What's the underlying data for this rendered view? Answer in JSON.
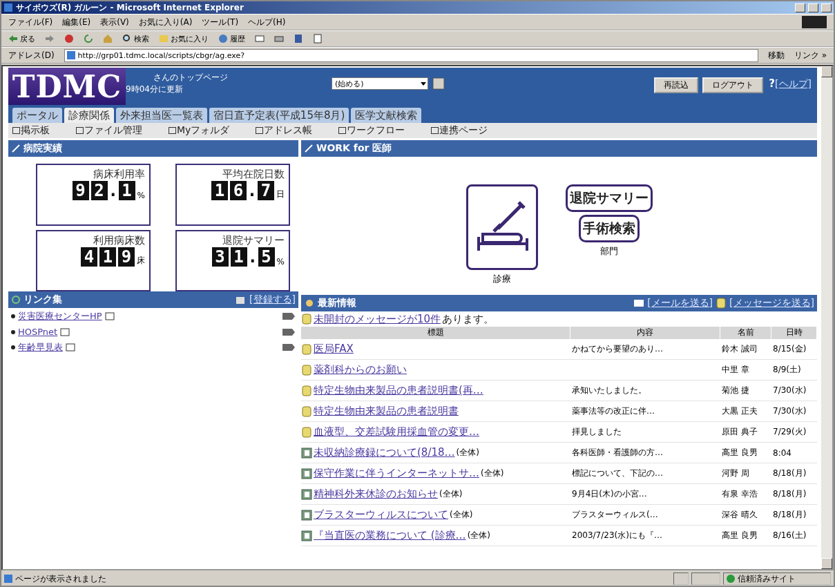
{
  "window": {
    "title": "サイボウズ(R) ガルーン - Microsoft Internet Explorer"
  },
  "menu": [
    "ファイル(F)",
    "編集(E)",
    "表示(V)",
    "お気に入り(A)",
    "ツール(T)",
    "ヘルプ(H)"
  ],
  "toolbar": [
    {
      "kind": "back",
      "label": "戻る"
    },
    {
      "kind": "forward"
    },
    {
      "kind": "stop"
    },
    {
      "kind": "refresh"
    },
    {
      "kind": "home"
    },
    {
      "kind": "search",
      "label": "検索"
    },
    {
      "kind": "favorites",
      "label": "お気に入り"
    },
    {
      "kind": "history",
      "label": "履歴"
    },
    {
      "kind": "mail"
    },
    {
      "kind": "print"
    },
    {
      "kind": "edit"
    },
    {
      "kind": "discuss"
    }
  ],
  "address": {
    "label": "アドレス(D)",
    "url": "http://grp01.tdmc.local/scripts/cbgr/ag.exe?",
    "go": "移動",
    "links": "リンク »"
  },
  "header": {
    "logo": "TDMC",
    "greeting": "さんのトップページ",
    "updated": "9時04分に更新",
    "select": "(始める)",
    "buttons": [
      "再読込",
      "ログアウト"
    ],
    "help_mark": "?",
    "help_link": "[ヘルプ]"
  },
  "tabs": [
    {
      "label": "ポータル",
      "selected": false
    },
    {
      "label": "診療関係",
      "selected": true
    },
    {
      "label": "外来担当医一覧表",
      "selected": false
    },
    {
      "label": "宿日直予定表(平成15年8月)",
      "selected": false
    },
    {
      "label": "医学文献検索",
      "selected": false
    }
  ],
  "subnav": [
    "掲示板",
    "ファイル管理",
    "Myフォルダ",
    "アドレス帳",
    "ワークフロー",
    "連携ページ"
  ],
  "stats": {
    "title": "病院実績",
    "items": [
      {
        "label": "病床利用率",
        "digits": [
          "9",
          "2",
          ".",
          "1"
        ],
        "unit": "%"
      },
      {
        "label": "平均在院日数",
        "digits": [
          "1",
          "6",
          ".",
          "7"
        ],
        "unit": "日"
      },
      {
        "label": "利用病床数",
        "digits": [
          "4",
          "1",
          "9"
        ],
        "unit": "床"
      },
      {
        "label": "退院サマリー",
        "digits": [
          "3",
          "1",
          ".",
          "5"
        ],
        "unit": "%"
      }
    ]
  },
  "links": {
    "title": "リンク集",
    "register": "[登録する]",
    "items": [
      "災害医療センターHP",
      "HOSPnet",
      "年齢早見表"
    ]
  },
  "work": {
    "title": "WORK for 医師",
    "main_label": "診療",
    "buttons": [
      "退院サマリー",
      "手術検索"
    ],
    "dept_label": "部門"
  },
  "news": {
    "title": "最新情報",
    "send_mail": "[メールを送る]",
    "send_message": "[メッセージを送る]",
    "unread_link": "未開封のメッセージが10件",
    "unread_rest": "あります。",
    "columns": [
      "標題",
      "内容",
      "名前",
      "日時"
    ],
    "rows": [
      {
        "kind": "message",
        "title": "医局FAX",
        "content": "かねてから要望のあり…",
        "name": "鈴木 誠司",
        "date": "8/15(金)"
      },
      {
        "kind": "message",
        "title": "薬剤科からのお願い",
        "name": "中里 章",
        "date": "8/9(土)"
      },
      {
        "kind": "message",
        "title": "特定生物由来製品の患者説明書(再…",
        "content": "承知いたしました。",
        "name": "菊池 捷",
        "date": "7/30(水)"
      },
      {
        "kind": "message",
        "title": "特定生物由来製品の患者説明書",
        "content": "薬事法等の改正に伴…",
        "name": "大黒 正夫",
        "date": "7/30(水)"
      },
      {
        "kind": "message",
        "title": "血液型、交差試験用採血管の変更…",
        "content": "拝見しました",
        "name": "原田 典子",
        "date": "7/29(火)"
      },
      {
        "kind": "bulletin",
        "title": "未収納診療録について(8/18…",
        "scope": "(全体)",
        "content": "各科医師・看護師の方…",
        "name": "高里 良男",
        "date": "8:04"
      },
      {
        "kind": "bulletin",
        "title": "保守作業に伴うインターネットサ…",
        "scope": "(全体)",
        "content": "標記について、下記の…",
        "name": "河野 周",
        "date": "8/18(月)"
      },
      {
        "kind": "bulletin",
        "title": "精神科外来休診のお知らせ",
        "scope": "(全体)",
        "content": "9月4日(木)の小宮…",
        "name": "有泉 幸浩",
        "date": "8/18(月)"
      },
      {
        "kind": "bulletin",
        "title": "ブラスターウィルスについて",
        "scope": "(全体)",
        "content": "ブラスターウィルス(…",
        "name": "深谷 晴久",
        "date": "8/18(月)"
      },
      {
        "kind": "bulletin",
        "title": "『当直医の業務について (診療…",
        "scope": "(全体)",
        "content": "2003/7/23(水)にも『…",
        "name": "高里 良男",
        "date": "8/16(土)"
      }
    ]
  },
  "status": {
    "text": "ページが表示されました",
    "zone": "信頼済みサイト"
  }
}
